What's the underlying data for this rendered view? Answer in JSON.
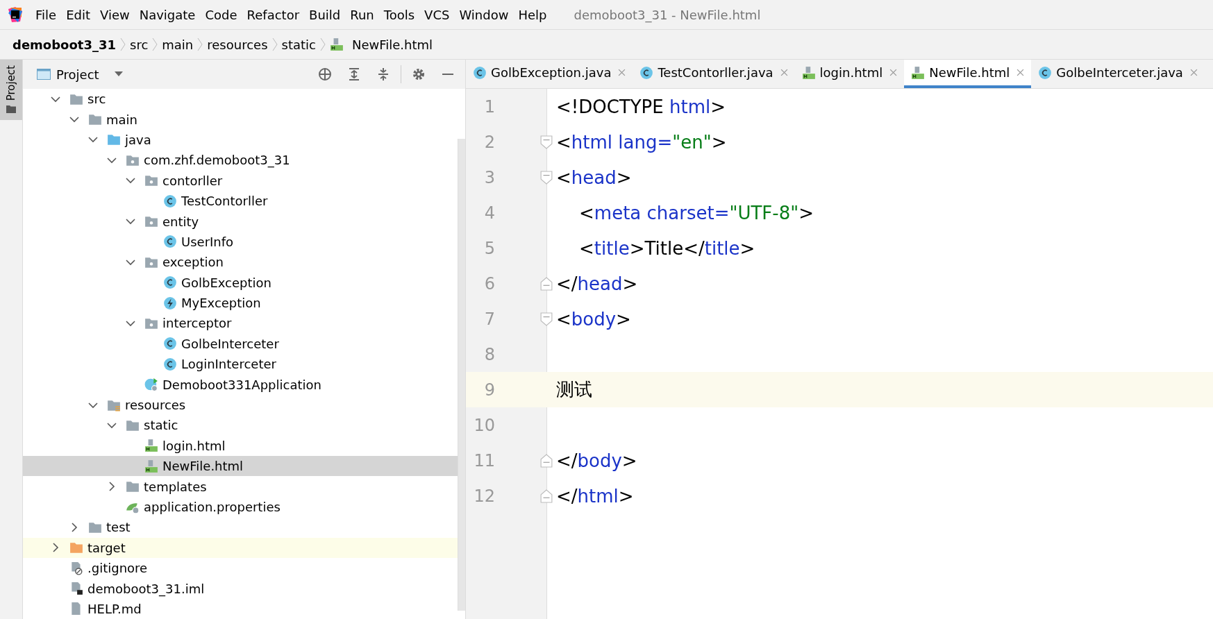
{
  "menu": [
    "File",
    "Edit",
    "View",
    "Navigate",
    "Code",
    "Refactor",
    "Build",
    "Run",
    "Tools",
    "VCS",
    "Window",
    "Help"
  ],
  "window": {
    "title": "demoboot3_31 - NewFile.html"
  },
  "breadcrumbs": [
    {
      "label": "demoboot3_31",
      "kind": "project"
    },
    {
      "label": "src",
      "kind": "dir"
    },
    {
      "label": "main",
      "kind": "dir"
    },
    {
      "label": "resources",
      "kind": "dir"
    },
    {
      "label": "static",
      "kind": "dir"
    },
    {
      "label": "NewFile.html",
      "kind": "html"
    }
  ],
  "tool_stripe": {
    "label": "Project",
    "selected": true
  },
  "project_panel": {
    "title": "Project",
    "tree": [
      {
        "label": "src",
        "kind": "folder",
        "selected": false,
        "expanded": true,
        "children": [
          {
            "label": "main",
            "kind": "folder",
            "selected": false,
            "expanded": true,
            "children": [
              {
                "label": "java",
                "kind": "source",
                "selected": false,
                "expanded": true,
                "children": [
                  {
                    "label": "com.zhf.demoboot3_31",
                    "kind": "package",
                    "selected": false,
                    "expanded": true,
                    "children": [
                      {
                        "label": "contorller",
                        "kind": "package",
                        "selected": false,
                        "expanded": true,
                        "children": [
                          {
                            "label": "TestContorller",
                            "kind": "class",
                            "selected": false
                          }
                        ]
                      },
                      {
                        "label": "entity",
                        "kind": "package",
                        "selected": false,
                        "expanded": true,
                        "children": [
                          {
                            "label": "UserInfo",
                            "kind": "class",
                            "selected": false
                          }
                        ]
                      },
                      {
                        "label": "exception",
                        "kind": "package",
                        "selected": false,
                        "expanded": true,
                        "children": [
                          {
                            "label": "GolbException",
                            "kind": "class",
                            "selected": false
                          },
                          {
                            "label": "MyException",
                            "kind": "exception",
                            "selected": false
                          }
                        ]
                      },
                      {
                        "label": "interceptor",
                        "kind": "package",
                        "selected": false,
                        "expanded": true,
                        "children": [
                          {
                            "label": "GolbeInterceter",
                            "kind": "class",
                            "selected": false
                          },
                          {
                            "label": "LoginInterceter",
                            "kind": "class",
                            "selected": false
                          }
                        ]
                      },
                      {
                        "label": "Demoboot331Application",
                        "kind": "app",
                        "selected": false
                      }
                    ]
                  }
                ]
              },
              {
                "label": "resources",
                "kind": "resources",
                "selected": false,
                "expanded": true,
                "children": [
                  {
                    "label": "static",
                    "kind": "folder",
                    "selected": false,
                    "expanded": true,
                    "children": [
                      {
                        "label": "login.html",
                        "kind": "html",
                        "selected": false
                      },
                      {
                        "label": "NewFile.html",
                        "kind": "html",
                        "selected": true
                      }
                    ]
                  },
                  {
                    "label": "templates",
                    "kind": "folder",
                    "selected": false,
                    "expanded": false
                  },
                  {
                    "label": "application.properties",
                    "kind": "properties",
                    "selected": false
                  }
                ]
              }
            ]
          },
          {
            "label": "test",
            "kind": "folder",
            "selected": false,
            "expanded": false
          }
        ]
      },
      {
        "label": "target",
        "kind": "excluded",
        "selected": false,
        "expanded": false,
        "highlighted": true
      },
      {
        "label": ".gitignore",
        "kind": "ignore",
        "selected": false
      },
      {
        "label": "demoboot3_31.iml",
        "kind": "iml",
        "selected": false
      },
      {
        "label": "HELP.md",
        "kind": "file",
        "selected": false
      }
    ]
  },
  "tabs": [
    {
      "label": "GolbException.java",
      "kind": "class",
      "selected": false
    },
    {
      "label": "TestContorller.java",
      "kind": "class",
      "selected": false
    },
    {
      "label": "login.html",
      "kind": "html",
      "selected": false
    },
    {
      "label": "NewFile.html",
      "kind": "html",
      "selected": true
    },
    {
      "label": "GolbeInterceter.java",
      "kind": "class",
      "selected": false
    }
  ],
  "editor": {
    "lines": [
      {
        "number": "1",
        "kind": "plain",
        "current": false,
        "tokens": [
          {
            "kind": "punct",
            "text": "<!DOCTYPE "
          },
          {
            "kind": "tag",
            "text": "html"
          },
          {
            "kind": "punct",
            "text": ">"
          }
        ]
      },
      {
        "number": "2",
        "kind": "fold_start",
        "current": false,
        "tokens": [
          {
            "kind": "punct",
            "text": "<"
          },
          {
            "kind": "tag",
            "text": "html "
          },
          {
            "kind": "attr",
            "text": "lang="
          },
          {
            "kind": "value",
            "text": "\"en\""
          },
          {
            "kind": "punct",
            "text": ">"
          }
        ]
      },
      {
        "number": "3",
        "kind": "fold_start",
        "current": false,
        "tokens": [
          {
            "kind": "punct",
            "text": "<"
          },
          {
            "kind": "tag",
            "text": "head"
          },
          {
            "kind": "punct",
            "text": ">"
          }
        ]
      },
      {
        "number": "4",
        "kind": "plain",
        "current": false,
        "tokens": [
          {
            "kind": "punct",
            "text": "    <"
          },
          {
            "kind": "tag",
            "text": "meta "
          },
          {
            "kind": "attr",
            "text": "charset="
          },
          {
            "kind": "value",
            "text": "\"UTF-8\""
          },
          {
            "kind": "punct",
            "text": ">"
          }
        ]
      },
      {
        "number": "5",
        "kind": "plain",
        "current": false,
        "tokens": [
          {
            "kind": "punct",
            "text": "    <"
          },
          {
            "kind": "tag",
            "text": "title"
          },
          {
            "kind": "punct",
            "text": ">Title</"
          },
          {
            "kind": "tag",
            "text": "title"
          },
          {
            "kind": "punct",
            "text": ">"
          }
        ]
      },
      {
        "number": "6",
        "kind": "fold_end",
        "current": false,
        "tokens": [
          {
            "kind": "punct",
            "text": "</"
          },
          {
            "kind": "tag",
            "text": "head"
          },
          {
            "kind": "punct",
            "text": ">"
          }
        ]
      },
      {
        "number": "7",
        "kind": "fold_start",
        "current": false,
        "tokens": [
          {
            "kind": "punct",
            "text": "<"
          },
          {
            "kind": "tag",
            "text": "body"
          },
          {
            "kind": "punct",
            "text": ">"
          }
        ]
      },
      {
        "number": "8",
        "kind": "plain",
        "current": false
      },
      {
        "number": "9",
        "kind": "plain",
        "current": true,
        "tokens": [
          {
            "kind": "text",
            "text": "测试"
          }
        ]
      },
      {
        "number": "10",
        "kind": "plain",
        "current": false
      },
      {
        "number": "11",
        "kind": "fold_end",
        "current": false,
        "tokens": [
          {
            "kind": "punct",
            "text": "</"
          },
          {
            "kind": "tag",
            "text": "body"
          },
          {
            "kind": "punct",
            "text": ">"
          }
        ]
      },
      {
        "number": "12",
        "kind": "fold_end",
        "current": false,
        "tokens": [
          {
            "kind": "punct",
            "text": "</"
          },
          {
            "kind": "tag",
            "text": "html"
          },
          {
            "kind": "punct",
            "text": ">"
          }
        ]
      }
    ]
  }
}
